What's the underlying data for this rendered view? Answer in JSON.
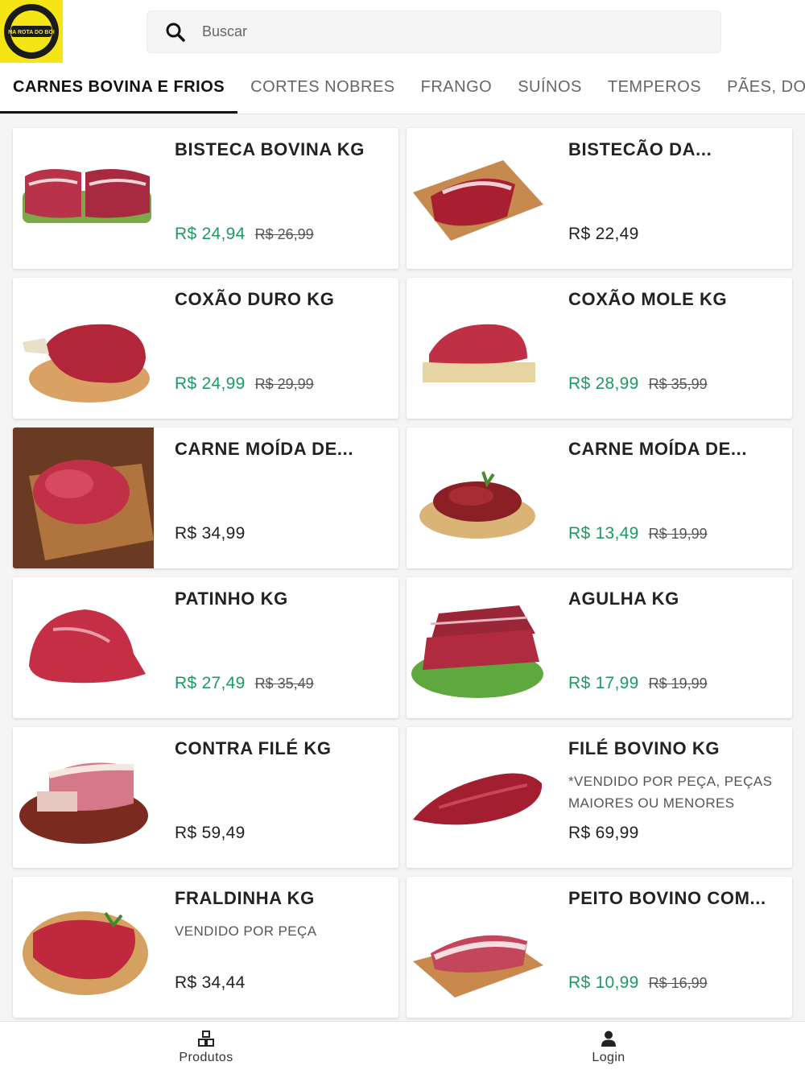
{
  "header": {
    "logo_text": "NA ROTA DO BOI",
    "search_placeholder": "Buscar"
  },
  "tabs": [
    {
      "label": "CARNES BOVINA E FRIOS",
      "active": true
    },
    {
      "label": "CORTES NOBRES"
    },
    {
      "label": "FRANGO"
    },
    {
      "label": "SUÍNOS"
    },
    {
      "label": "TEMPEROS"
    },
    {
      "label": "PÃES, DOCES"
    }
  ],
  "products": [
    {
      "title": "BISTECA BOVINA KG",
      "desc": "",
      "price": "R$ 24,94",
      "old_price": "R$ 26,99",
      "image": "bisteca-image"
    },
    {
      "title": "BISTECÃO DA...",
      "desc": "",
      "price": "R$ 22,49",
      "old_price": "",
      "image": "bistecao-image"
    },
    {
      "title": "COXÃO DURO KG",
      "desc": "",
      "price": "R$ 24,99",
      "old_price": "R$ 29,99",
      "image": "coxao-duro-image"
    },
    {
      "title": "COXÃO MOLE KG",
      "desc": "",
      "price": "R$ 28,99",
      "old_price": "R$ 35,99",
      "image": "coxao-mole-image"
    },
    {
      "title": "CARNE MOÍDA DE...",
      "desc": "",
      "price": "R$ 34,99",
      "old_price": "",
      "image": "carne-moida-image"
    },
    {
      "title": "CARNE MOÍDA DE...",
      "desc": "",
      "price": "R$ 13,49",
      "old_price": "R$ 19,99",
      "image": "carne-moida-prato-image"
    },
    {
      "title": "PATINHO KG",
      "desc": "",
      "price": "R$ 27,49",
      "old_price": "R$ 35,49",
      "image": "patinho-image"
    },
    {
      "title": "AGULHA KG",
      "desc": "",
      "price": "R$ 17,99",
      "old_price": "R$ 19,99",
      "image": "agulha-image"
    },
    {
      "title": "CONTRA FILÉ KG",
      "desc": "",
      "price": "R$ 59,49",
      "old_price": "",
      "image": "contra-file-image"
    },
    {
      "title": "FILÉ BOVINO KG",
      "desc": "*VENDIDO POR PEÇA, PEÇAS MAIORES OU MENORES",
      "price": "R$ 69,99",
      "old_price": "",
      "image": "file-bovino-image"
    },
    {
      "title": "FRALDINHA KG",
      "desc": "VENDIDO POR PEÇA",
      "price": "R$ 34,44",
      "old_price": "",
      "image": "fraldinha-image"
    },
    {
      "title": "PEITO BOVINO COM...",
      "desc": "",
      "price": "R$ 10,99",
      "old_price": "R$ 16,99",
      "image": "peito-bovino-image"
    }
  ],
  "bottom_nav": [
    {
      "label": "Produtos",
      "icon": "boxes-icon"
    },
    {
      "label": "Login",
      "icon": "user-icon"
    }
  ],
  "colors": {
    "promo_price": "#1a9b63",
    "logo_bg": "#f6e515",
    "meat": "#b3263a"
  }
}
